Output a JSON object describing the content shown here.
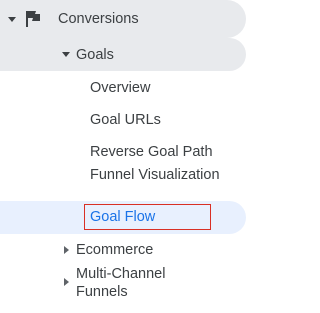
{
  "nav": {
    "conversions": {
      "label": "Conversions",
      "icon": "flag-icon"
    },
    "goals": {
      "label": "Goals"
    },
    "goal_items": [
      {
        "label": "Overview"
      },
      {
        "label": "Goal URLs"
      },
      {
        "label": "Reverse Goal Path"
      },
      {
        "label": "Funnel Visualization"
      },
      {
        "label": "Goal Flow",
        "active": true
      }
    ],
    "ecommerce": {
      "label": "Ecommerce"
    },
    "multi_channel": {
      "label": "Multi-Channel Funnels"
    }
  },
  "colors": {
    "section_bg": "#e8eaed",
    "active_bg": "#e8f0fe",
    "active_text": "#1a73e8",
    "highlight_border": "#d93025"
  }
}
